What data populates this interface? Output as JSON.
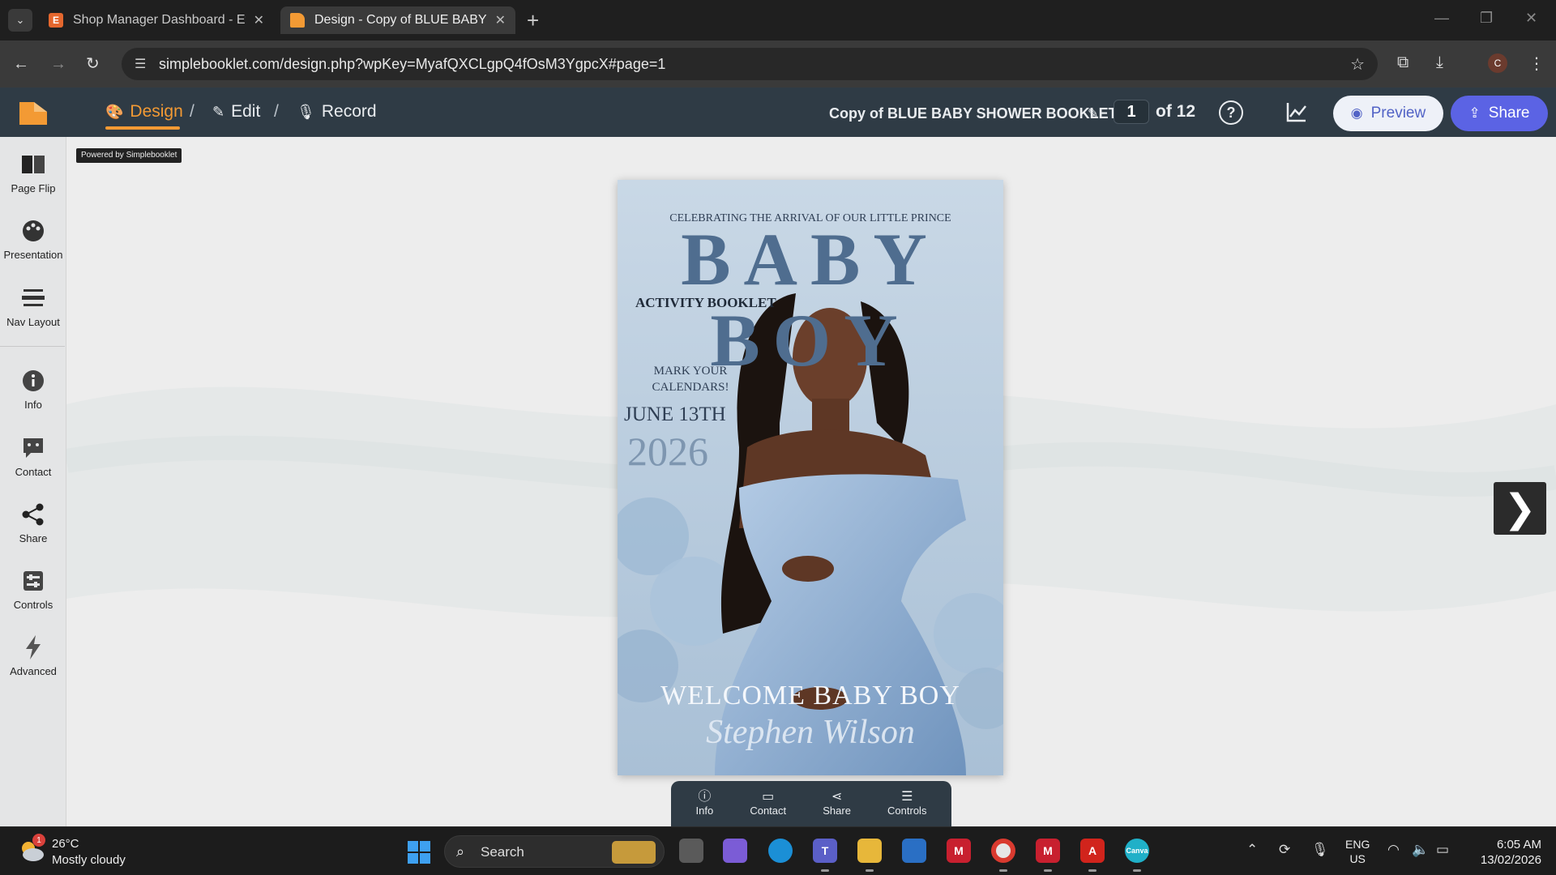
{
  "browser": {
    "tabs": [
      {
        "title": "Shop Manager Dashboard - Etsy",
        "favicon": "E",
        "active": false
      },
      {
        "title": "Design - Copy of BLUE BABY SHOWER BOOKLET",
        "favicon": "",
        "active": true
      }
    ],
    "url": "simplebooklet.com/design.php?wpKey=MyafQXCLgpQ4fOsM3YgpcX#page=1",
    "profile_initial": "C"
  },
  "app": {
    "modes": [
      "Design",
      "Edit",
      "Record"
    ],
    "active_mode": "Design",
    "doc_title": "Copy of BLUE BABY SHOWER BOOKLET",
    "page_current": "1",
    "page_total_label": "of 12",
    "preview_label": "Preview",
    "share_label": "Share",
    "accent_color": "#f39a34",
    "share_color": "#5b63e4"
  },
  "sidebar": {
    "items": [
      {
        "label": "Page Flip",
        "icon": "book-icon"
      },
      {
        "label": "Presentation",
        "icon": "palette-icon"
      },
      {
        "label": "Nav Layout",
        "icon": "layout-icon"
      },
      {
        "label": "Info",
        "icon": "info-icon"
      },
      {
        "label": "Contact",
        "icon": "chat-icon"
      },
      {
        "label": "Share",
        "icon": "share-icon"
      },
      {
        "label": "Controls",
        "icon": "controls-icon"
      },
      {
        "label": "Advanced",
        "icon": "bolt-icon"
      }
    ]
  },
  "canvas": {
    "powered_by": "Powered by Simplebooklet"
  },
  "booklet": {
    "subtitle": "CELEBRATING THE ARRIVAL OF OUR LITTLE PRINCE",
    "title": "BABY BOY",
    "kicker": "ACTIVITY BOOKLET",
    "mark_line1": "MARK YOUR",
    "mark_line2": "CALENDARS!",
    "date": "JUNE 13TH",
    "year": "2026",
    "welcome": "WELCOME BABY BOY",
    "signature": "Stephen Wilson"
  },
  "bottom_bar": {
    "items": [
      {
        "label": "Info",
        "icon": "info-icon"
      },
      {
        "label": "Contact",
        "icon": "chat-icon"
      },
      {
        "label": "Share",
        "icon": "share-icon"
      },
      {
        "label": "Controls",
        "icon": "controls-icon"
      }
    ]
  },
  "taskbar": {
    "weather_temp": "26°C",
    "weather_desc": "Mostly cloudy",
    "weather_badge": "1",
    "search_placeholder": "Search",
    "lang_line1": "ENG",
    "lang_line2": "US",
    "time": "6:05 AM",
    "date": "13/02/2026"
  }
}
